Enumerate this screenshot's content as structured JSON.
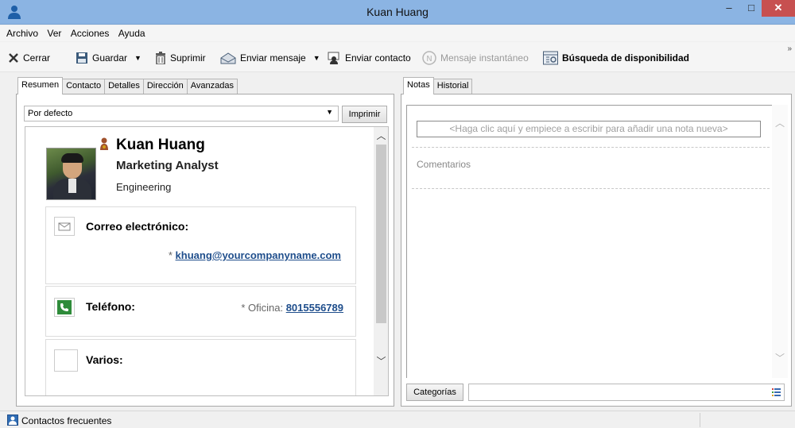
{
  "window": {
    "title": "Kuan Huang",
    "minimize_glyph": "–",
    "maximize_glyph": "□",
    "close_glyph": "✕"
  },
  "menu": [
    "Archivo",
    "Ver",
    "Acciones",
    "Ayuda"
  ],
  "toolbar": {
    "close_label": "Cerrar",
    "save_label": "Guardar",
    "delete_label": "Suprimir",
    "send_message_label": "Enviar mensaje",
    "send_contact_label": "Enviar contacto",
    "im_label": "Mensaje instantáneo",
    "availability_label": "Búsqueda de disponibilidad",
    "overflow_glyph": "»"
  },
  "left_tabs": [
    "Resumen",
    "Contacto",
    "Detalles",
    "Dirección",
    "Avanzadas"
  ],
  "view_select": {
    "value": "Por defecto",
    "print_label": "Imprimir"
  },
  "contact": {
    "name": "Kuan Huang",
    "job_title": "Marketing Analyst",
    "department": "Engineering",
    "email_heading": "Correo electrónico:",
    "email_prefix": "* ",
    "email": "khuang@yourcompanyname.com",
    "phone_heading": "Teléfono:",
    "phone_prefix": "* Oficina: ",
    "phone": "8015556789",
    "misc_heading": "Varios:"
  },
  "right_tabs": [
    "Notas",
    "Historial"
  ],
  "notes": {
    "new_note_placeholder": "<Haga clic aquí y empiece a escribir para añadir una nota nueva>",
    "comments_label": "Comentarios",
    "categories_label": "Categorías",
    "categories_value": ""
  },
  "status": {
    "text": "Contactos frecuentes"
  },
  "colors": {
    "titlebar": "#8bb4e3",
    "close_button": "#c75050",
    "link": "#1f4e8c",
    "phone_icon": "#2e8b3a"
  },
  "icons": [
    "contact-icon",
    "close-icon",
    "save-icon",
    "delete-icon",
    "send-message-icon",
    "send-contact-icon",
    "instant-message-icon",
    "availability-icon",
    "email-icon",
    "phone-icon",
    "misc-icon",
    "categories-list-icon",
    "contact-card-icon"
  ]
}
